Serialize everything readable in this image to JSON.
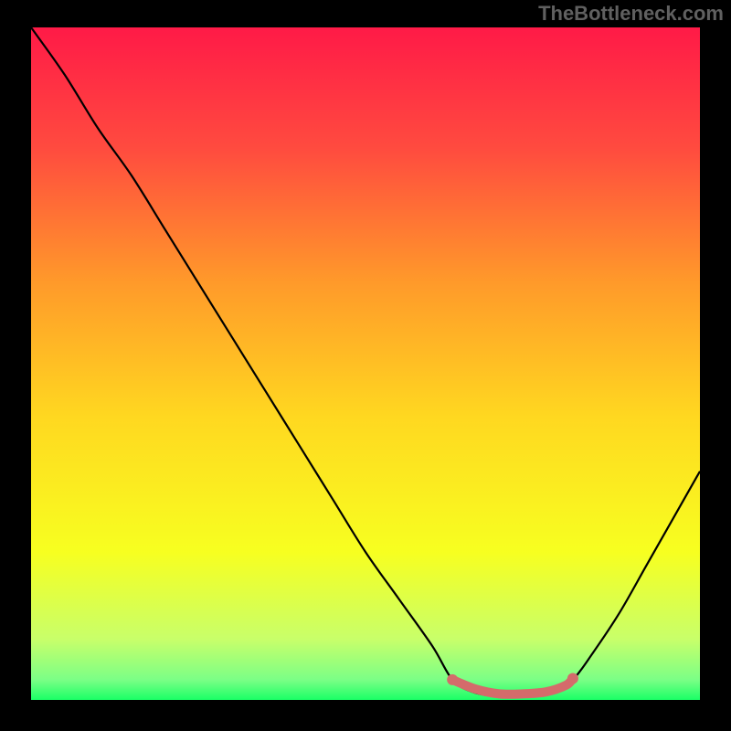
{
  "watermark": "TheBottleneck.com",
  "chart_data": {
    "type": "line",
    "title": "",
    "xlabel": "",
    "ylabel": "",
    "xlim": [
      0,
      100
    ],
    "ylim": [
      0,
      100
    ],
    "background_gradient": {
      "stops": [
        {
          "offset": 0,
          "color": "#ff1a47"
        },
        {
          "offset": 0.18,
          "color": "#ff4b3f"
        },
        {
          "offset": 0.38,
          "color": "#ff9a2a"
        },
        {
          "offset": 0.58,
          "color": "#ffd820"
        },
        {
          "offset": 0.78,
          "color": "#f7ff20"
        },
        {
          "offset": 0.91,
          "color": "#c8ff6a"
        },
        {
          "offset": 0.97,
          "color": "#7bff86"
        },
        {
          "offset": 1.0,
          "color": "#1aff66"
        }
      ]
    },
    "series": [
      {
        "name": "bottleneck-curve",
        "color": "#000000",
        "x": [
          0,
          5,
          10,
          15,
          20,
          25,
          30,
          35,
          40,
          45,
          50,
          55,
          60,
          63,
          66,
          70,
          74,
          78,
          81,
          84,
          88,
          92,
          96,
          100
        ],
        "y": [
          100,
          93,
          85,
          78,
          70,
          62,
          54,
          46,
          38,
          30,
          22,
          15,
          8,
          3,
          1.2,
          0.5,
          0.5,
          1.0,
          3,
          7,
          13,
          20,
          27,
          34
        ]
      }
    ],
    "highlight": {
      "name": "optimal-zone",
      "color": "#d46b6b",
      "x": [
        63,
        66.5,
        70,
        73.5,
        77,
        80,
        81
      ],
      "y": [
        3.0,
        1.6,
        0.9,
        0.9,
        1.2,
        2.2,
        3.2
      ]
    }
  }
}
